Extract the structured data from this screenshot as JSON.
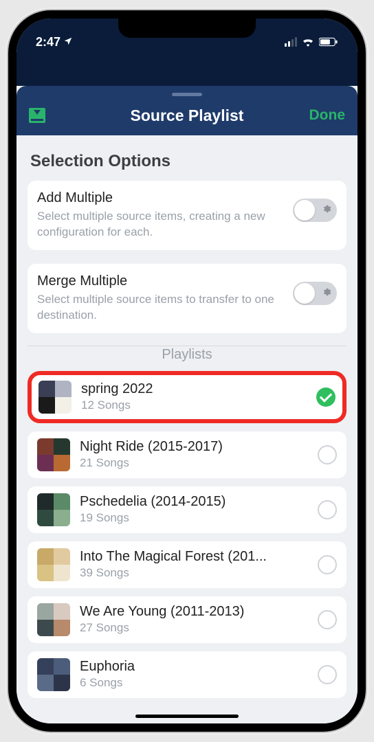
{
  "status": {
    "time": "2:47",
    "locationActive": true
  },
  "header": {
    "title": "Source Playlist",
    "done": "Done"
  },
  "section": {
    "title": "Selection Options",
    "options": [
      {
        "title": "Add Multiple",
        "sub": "Select multiple source items, creating a new configuration for each.",
        "on": false
      },
      {
        "title": "Merge Multiple",
        "sub": "Select multiple source items to transfer to one destination.",
        "on": false
      }
    ]
  },
  "playlistsLabel": "Playlists",
  "playlists": [
    {
      "title": "spring 2022",
      "sub": "12 Songs",
      "selected": true,
      "highlighted": true,
      "art": [
        "#3b3f55",
        "#b0b4c2",
        "#1a1a1a",
        "#f3f0e8"
      ]
    },
    {
      "title": "Night Ride (2015-2017)",
      "sub": "21 Songs",
      "selected": false,
      "highlighted": false,
      "art": [
        "#7a3a2e",
        "#25382f",
        "#6d2e54",
        "#b86a32"
      ]
    },
    {
      "title": "Pschedelia (2014-2015)",
      "sub": "19 Songs",
      "selected": false,
      "highlighted": false,
      "art": [
        "#1f2b2a",
        "#5a8a68",
        "#2f4a3e",
        "#8aae8e"
      ]
    },
    {
      "title": "Into The Magical Forest (201...",
      "sub": "39 Songs",
      "selected": false,
      "highlighted": false,
      "art": [
        "#c9a968",
        "#e2caa0",
        "#d8c284",
        "#efe5cf"
      ]
    },
    {
      "title": "We Are Young (2011-2013)",
      "sub": "27 Songs",
      "selected": false,
      "highlighted": false,
      "art": [
        "#9aa6a0",
        "#d8cabf",
        "#3d4a4d",
        "#b68a6a"
      ]
    },
    {
      "title": "Euphoria",
      "sub": "6 Songs",
      "selected": false,
      "highlighted": false,
      "art": [
        "#35405a",
        "#4b5d7a",
        "#5a6b88",
        "#2b3448"
      ]
    }
  ]
}
